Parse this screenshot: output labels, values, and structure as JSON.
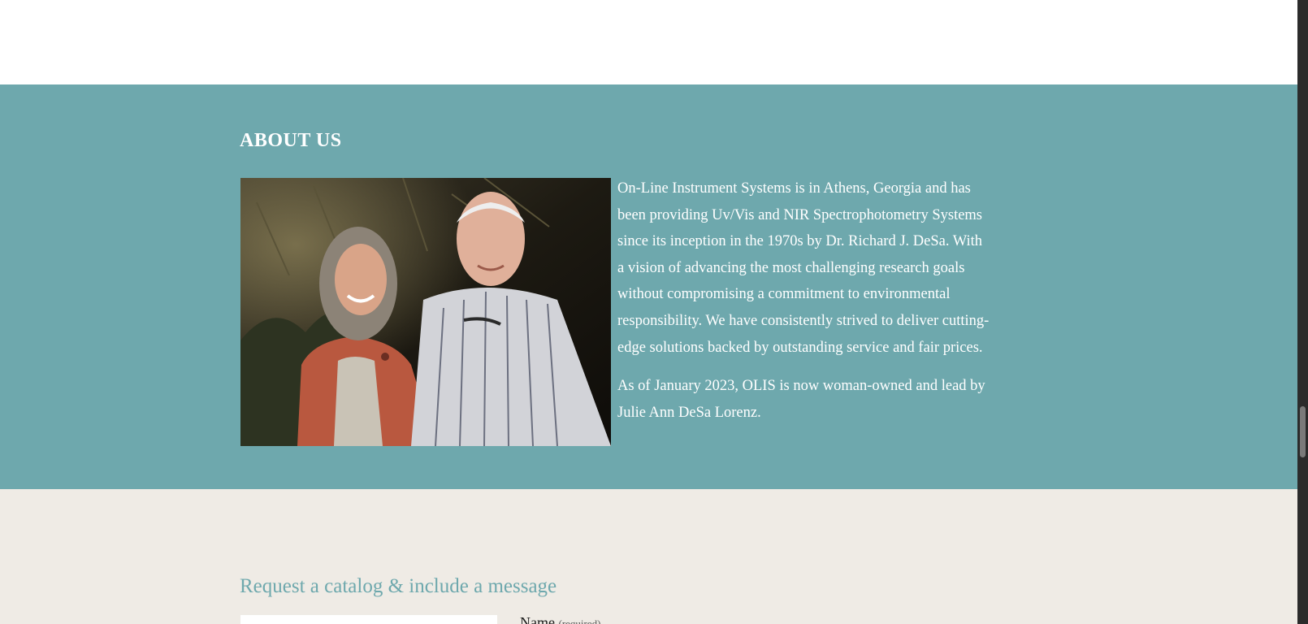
{
  "about": {
    "heading": "ABOUT US",
    "paragraph_1": "On-Line Instrument Systems is in Athens, Georgia and has been providing Uv/Vis and NIR Spectrophotometry Systems since its inception in the 1970s by Dr. Richard J. DeSa. With a vision of advancing the most challenging research goals without compromising a commitment to environmental responsibility.  We have consistently strived to deliver cutting-edge solutions backed by outstanding service and fair prices.",
    "paragraph_2": "As of January 2023, OLIS is now woman-owned and lead by Julie Ann DeSa Lorenz.",
    "background_color": "#6ea8ad"
  },
  "contact": {
    "heading": "Request a catalog & include a message",
    "name_label": "Name",
    "name_required": "(required)",
    "name_value": "",
    "background_color": "#efebe5"
  }
}
